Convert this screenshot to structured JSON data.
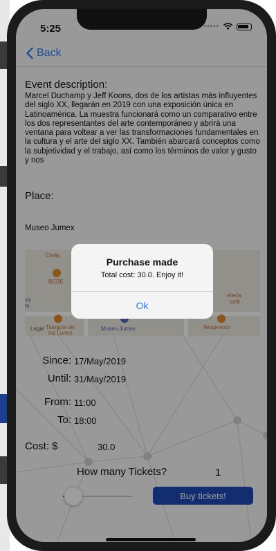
{
  "status_bar": {
    "time": "5:25"
  },
  "navbar": {
    "back_label": "Back"
  },
  "event": {
    "description_label": "Event description:",
    "description": "Marcel Duchamp y Jeff Koons, dos de los artistas más influyentes del siglo XX, llegarán en 2019 con una exposición única en Latinoamérica. La muestra funcionará como un comparativo entre los dos representantes del arte contemporáneo y abrirá una ventana para voltear a ver las transformaciones fundamentales en la cultura y el arte del siglo XX. También abarcará conceptos como la subjetividad y el trabajo, así como los términos de valor y gusto y nos",
    "place_label": "Place:",
    "place": "Museo Jumex"
  },
  "map": {
    "labels": {
      "cinep": "Cinép",
      "bcbe": "BCBE",
      "ya": "ya",
      "m": "m",
      "cafeteria": "etería",
      "cafe": "café",
      "tianguis": "Tianguis de",
      "lunes": "los Lunes",
      "museo": "Museo Jumex",
      "nespresso": "Nespresso",
      "legal": "Legal"
    }
  },
  "dates": {
    "since_label": "Since:",
    "since": "17/May/2019",
    "until_label": "Until:",
    "until": "31/May/2019"
  },
  "times": {
    "from_label": "From:",
    "from": "11:00",
    "to_label": "To:",
    "to": "18:00"
  },
  "cost": {
    "label": "Cost: $",
    "value": "30.0"
  },
  "tickets": {
    "label": "How many Tickets?",
    "count": "1",
    "slider_fraction": 0.15,
    "buy_label": "Buy tickets!"
  },
  "alert": {
    "title": "Purchase made",
    "message": "Total cost: 30.0. Enjoy it!",
    "ok_label": "Ok"
  },
  "colors": {
    "accent": "#2a7cf6",
    "button": "#1e4bb6"
  }
}
